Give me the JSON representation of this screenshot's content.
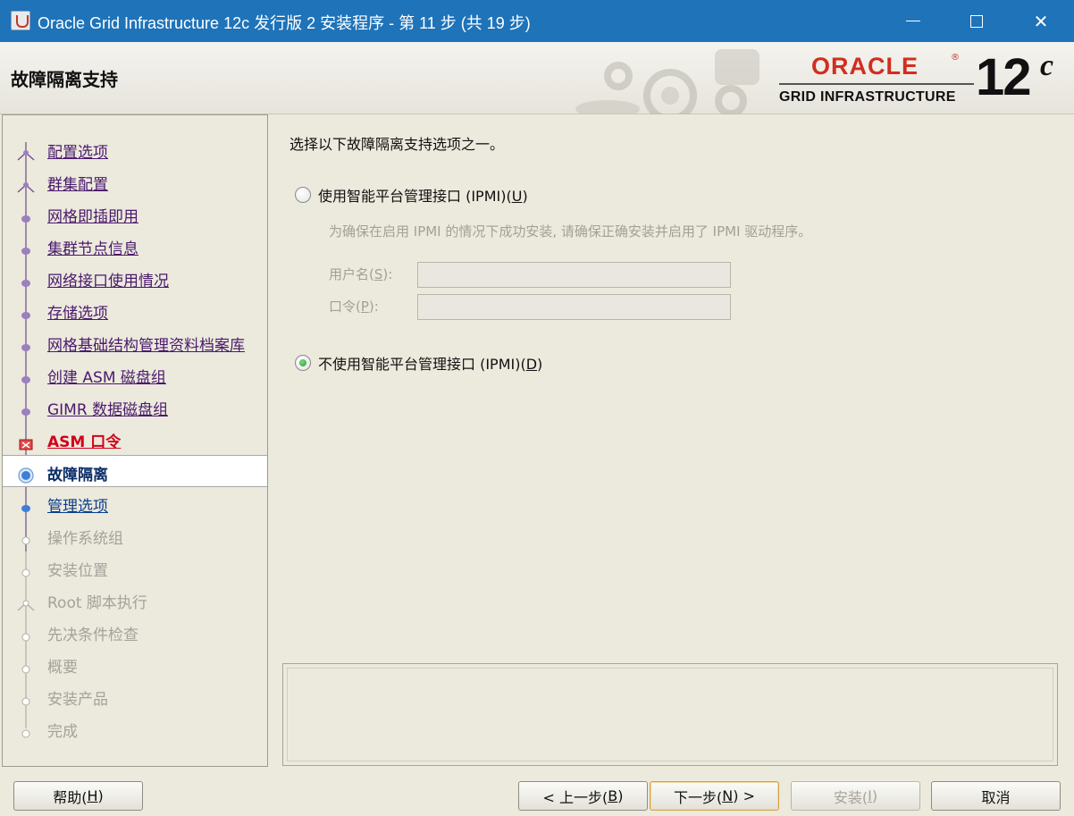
{
  "window": {
    "title": "Oracle Grid Infrastructure 12c 发行版 2 安装程序 - 第 11 步 (共 19 步)",
    "minimize_glyph": "—",
    "maximize_glyph": "☐",
    "close_glyph": "✕"
  },
  "header": {
    "page_title": "故障隔离支持",
    "logo": {
      "brand": "ORACLE",
      "reg": "®",
      "product": "GRID INFRASTRUCTURE",
      "version": "12",
      "version_suffix": "c"
    }
  },
  "steps": [
    {
      "label": "配置选项",
      "state": "done"
    },
    {
      "label": "群集配置",
      "state": "done"
    },
    {
      "label": "网格即插即用",
      "state": "done"
    },
    {
      "label": "集群节点信息",
      "state": "done"
    },
    {
      "label": "网络接口使用情况",
      "state": "done"
    },
    {
      "label": "存储选项",
      "state": "done"
    },
    {
      "label": "网格基础结构管理资料档案库",
      "state": "done"
    },
    {
      "label": "创建 ASM 磁盘组",
      "state": "done"
    },
    {
      "label": "GIMR 数据磁盘组",
      "state": "done"
    },
    {
      "label": "ASM 口令",
      "state": "error"
    },
    {
      "label": "故障隔离",
      "state": "current"
    },
    {
      "label": "管理选项",
      "state": "next"
    },
    {
      "label": "操作系统组",
      "state": "todo"
    },
    {
      "label": "安装位置",
      "state": "todo"
    },
    {
      "label": "Root 脚本执行",
      "state": "todo"
    },
    {
      "label": "先决条件检查",
      "state": "todo"
    },
    {
      "label": "概要",
      "state": "todo"
    },
    {
      "label": "安装产品",
      "state": "todo"
    },
    {
      "label": "完成",
      "state": "todo"
    }
  ],
  "content": {
    "instruction": "选择以下故障隔离支持选项之一。",
    "option_ipmi": {
      "label": "使用智能平台管理接口 (IPMI)(",
      "mnemonic": "U",
      "close": ")",
      "selected": false
    },
    "hint": "为确保在启用 IPMI 的情况下成功安装, 请确保正确安装并启用了 IPMI 驱动程序。",
    "username": {
      "label": "用户名(",
      "mnemonic": "S",
      "close": "):",
      "value": ""
    },
    "password": {
      "label": "口令(",
      "mnemonic": "P",
      "close": "):",
      "value": ""
    },
    "option_no_ipmi": {
      "label": "不使用智能平台管理接口 (IPMI)(",
      "mnemonic": "D",
      "close": ")",
      "selected": true
    }
  },
  "buttons": {
    "help": {
      "label": "帮助(",
      "mnemonic": "H",
      "close": ")"
    },
    "back": {
      "label": "< 上一步(",
      "mnemonic": "B",
      "close": ")"
    },
    "next": {
      "label": "下一步(",
      "mnemonic": "N",
      "close": ") >"
    },
    "install": {
      "label": "安装(",
      "mnemonic": "I",
      "close": ")"
    },
    "cancel": {
      "label": "取消"
    }
  },
  "colors": {
    "titlebar": "#1e73b9",
    "done_link": "#4a1a6d",
    "error": "#d0021b",
    "current_node": "#3d7fd6",
    "oracle_red": "#d12e1f"
  }
}
